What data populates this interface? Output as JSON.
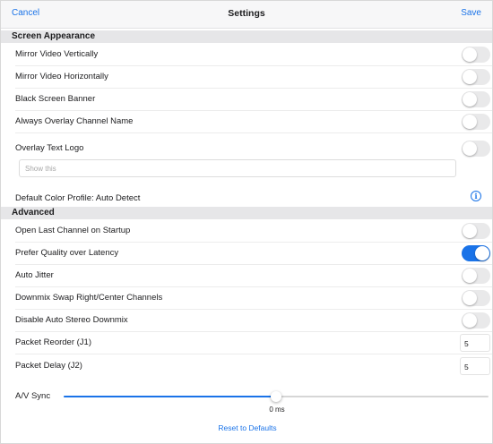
{
  "navbar": {
    "cancel": "Cancel",
    "title": "Settings",
    "save": "Save"
  },
  "sections": {
    "appearance": "Screen Appearance",
    "advanced": "Advanced"
  },
  "appearance": {
    "mirror_vertical": {
      "label": "Mirror Video Vertically",
      "on": false
    },
    "mirror_horizontal": {
      "label": "Mirror Video Horizontally",
      "on": false
    },
    "black_banner": {
      "label": "Black Screen Banner",
      "on": false
    },
    "overlay_channel": {
      "label": "Always Overlay Channel Name",
      "on": false
    },
    "overlay_logo": {
      "label": "Overlay Text Logo",
      "on": false
    },
    "logo_input": {
      "placeholder": "Show this",
      "value": ""
    },
    "color_profile": "Default Color Profile:  Auto Detect"
  },
  "advanced": {
    "open_last": {
      "label": "Open Last Channel on Startup",
      "on": false
    },
    "prefer_quality": {
      "label": "Prefer Quality over Latency",
      "on": true
    },
    "auto_jitter": {
      "label": "Auto Jitter",
      "on": false
    },
    "downmix_swap": {
      "label": "Downmix Swap Right/Center Channels",
      "on": false
    },
    "disable_downmix": {
      "label": "Disable Auto Stereo Downmix",
      "on": false
    },
    "packet_reorder": {
      "label": "Packet Reorder (J1)",
      "value": "5"
    },
    "packet_delay": {
      "label": "Packet Delay (J2)",
      "value": "5"
    },
    "av_sync": {
      "label": "A/V Sync",
      "value": "0 ms",
      "fraction": 0.5
    }
  },
  "reset_label": "Reset to Defaults",
  "colors": {
    "accent": "#1a73e8",
    "section_bg": "#e6e6e8",
    "toggle_off": "#e9e9ea"
  }
}
